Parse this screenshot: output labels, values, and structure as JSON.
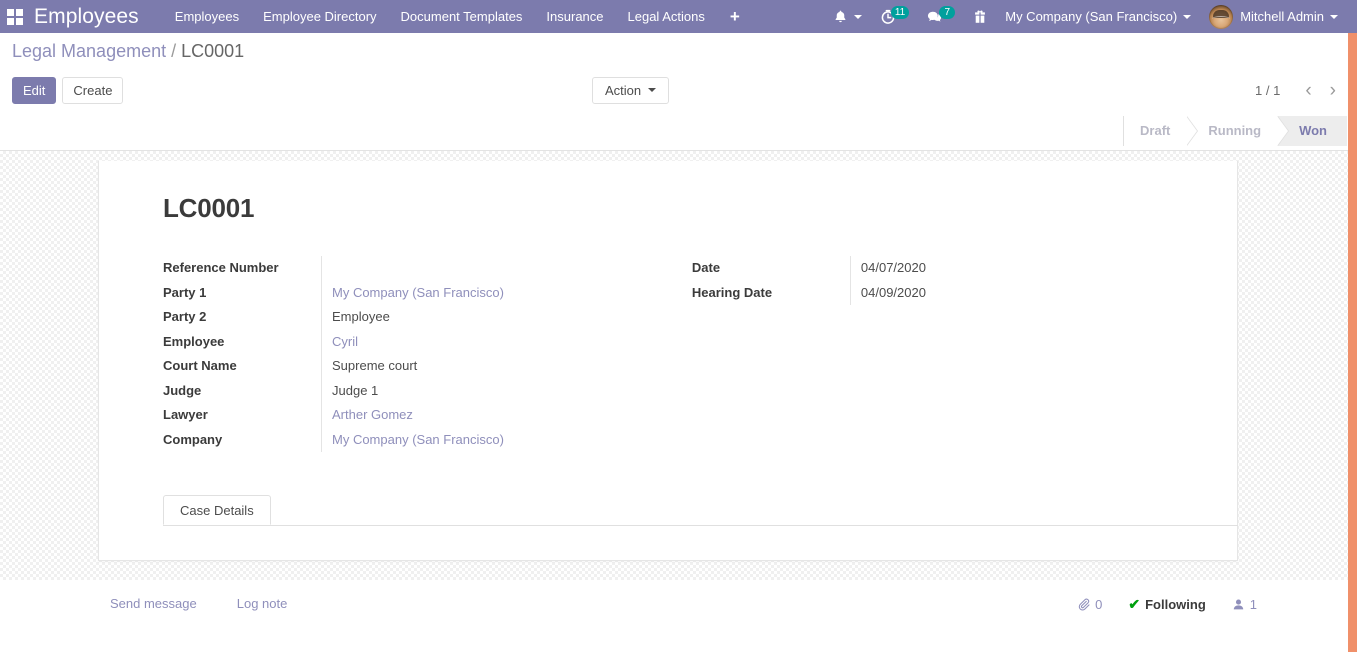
{
  "navbar": {
    "apps_icon": "apps-grid-icon",
    "brand": "Employees",
    "menu_items": [
      {
        "label": "Employees"
      },
      {
        "label": "Employee Directory"
      },
      {
        "label": "Document Templates"
      },
      {
        "label": "Insurance"
      },
      {
        "label": "Legal Actions"
      }
    ],
    "add_menu_label": "+",
    "icons": {
      "activity_bell": "bell-icon",
      "timer": "timer-icon",
      "messages": "chat-bubble-icon",
      "gift": "gift-icon"
    },
    "counters": {
      "timer": "11",
      "messages": "7"
    },
    "company": "My Company (San Francisco)",
    "user": "Mitchell Admin",
    "avatar": "user-avatar"
  },
  "breadcrumb": {
    "parent": "Legal Management",
    "separator": "/",
    "current": "LC0001"
  },
  "controls": {
    "edit_label": "Edit",
    "create_label": "Create",
    "action_label": "Action",
    "pager_text": "1 / 1",
    "prev_icon": "chevron-left-icon",
    "next_icon": "chevron-right-icon"
  },
  "statusbar": {
    "stages": [
      {
        "label": "Draft",
        "active": false
      },
      {
        "label": "Running",
        "active": false
      },
      {
        "label": "Won",
        "active": true
      }
    ]
  },
  "record": {
    "title": "LC0001",
    "left_fields": [
      {
        "label": "Reference Number",
        "value": "",
        "link": false
      },
      {
        "label": "Party 1",
        "value": "My Company (San Francisco)",
        "link": true
      },
      {
        "label": "Party 2",
        "value": "Employee",
        "link": false
      },
      {
        "label": "Employee",
        "value": "Cyril",
        "link": true
      },
      {
        "label": "Court Name",
        "value": "Supreme court",
        "link": false
      },
      {
        "label": "Judge",
        "value": "Judge 1",
        "link": false
      },
      {
        "label": "Lawyer",
        "value": "Arther Gomez",
        "link": true
      },
      {
        "label": "Company",
        "value": "My Company (San Francisco)",
        "link": true
      }
    ],
    "right_fields": [
      {
        "label": "Date",
        "value": "04/07/2020",
        "link": false
      },
      {
        "label": "Hearing Date",
        "value": "04/09/2020",
        "link": false
      }
    ],
    "tabs": [
      {
        "label": "Case Details",
        "active": true
      }
    ]
  },
  "chatter": {
    "send_message": "Send message",
    "log_note": "Log note",
    "attachment_icon": "paperclip-icon",
    "attachment_count": "0",
    "following_icon": "check-icon",
    "following_label": "Following",
    "followers_icon": "user-icon",
    "followers_count": "1"
  },
  "colors": {
    "brand_purple": "#7c7bad",
    "link_purple": "#8f8fbb",
    "badge_teal": "#00a09d",
    "edge_orange": "#f0906a",
    "check_green": "#00a00e"
  }
}
